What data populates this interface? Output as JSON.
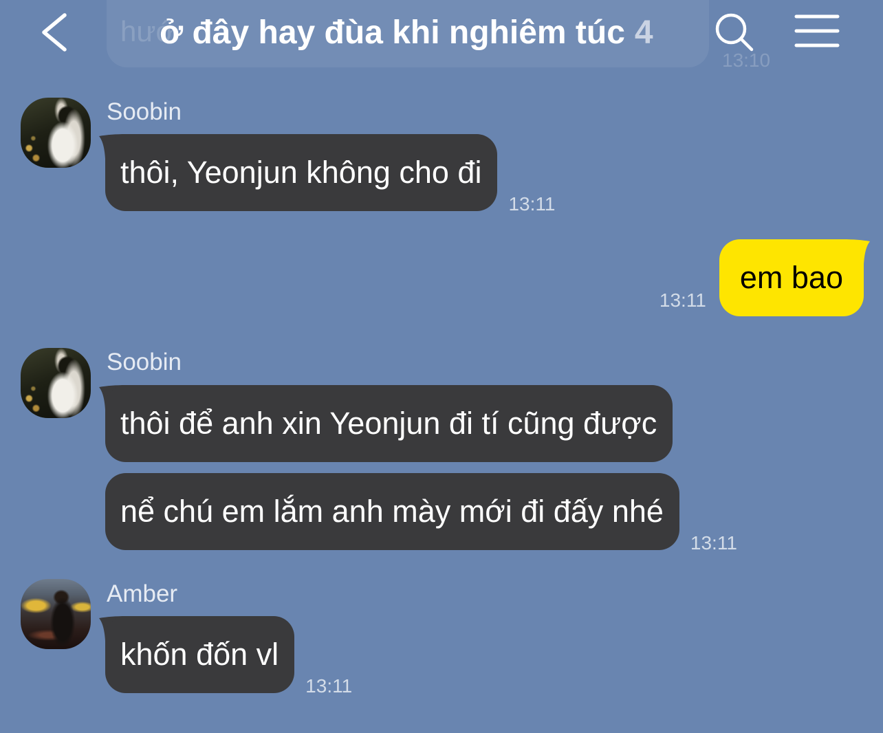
{
  "header": {
    "title": "ở đây hay đùa khi nghiêm túc",
    "member_count": "4"
  },
  "icons": {
    "back": "chevron-left-icon",
    "search": "search-icon",
    "menu": "menu-icon"
  },
  "colors": {
    "background": "#6985B0",
    "received_bubble": "#3A3A3C",
    "sent_bubble": "#FEE500",
    "received_text": "#FFFFFF",
    "sent_text": "#000000"
  },
  "previous_message": {
    "visible_text": "hướ",
    "time": "13:10"
  },
  "messages": [
    {
      "sender": "Soobin",
      "bubbles": [
        "thôi, Yeonjun không cho đi"
      ],
      "time": "13:11"
    },
    {
      "bubbles": [
        "em bao"
      ],
      "time": "13:11"
    },
    {
      "sender": "Soobin",
      "bubbles": [
        "thôi để anh xin Yeonjun đi tí cũng được",
        "nể chú em lắm anh mày mới đi đấy nhé"
      ],
      "time": "13:11"
    },
    {
      "sender": "Amber",
      "bubbles": [
        "khốn đốn vl"
      ],
      "time": "13:11"
    }
  ]
}
